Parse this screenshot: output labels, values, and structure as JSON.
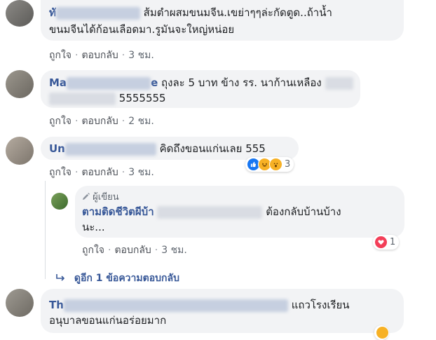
{
  "comments": [
    {
      "name_visible": "ทั",
      "text": "ส้มตำผสมขนมจีน.เขย่าๆๆล่ะกัดตูด..ถ้าน้ำ",
      "text2": "ขนมจีนได้ก้อนเลือดมา.รูมันจะใหญ่หน่อย",
      "like": "ถูกใจ",
      "reply": "ตอบกลับ",
      "time": "3 ชม."
    },
    {
      "name_visible": "Ma",
      "name_suffix": "e",
      "text": "ถุงละ 5 บาท ข้าง รร. นาก้านเหลือง",
      "text2": "5555555",
      "like": "ถูกใจ",
      "reply": "ตอบกลับ",
      "time": "2 ชม."
    },
    {
      "name_visible": "Un",
      "text": "คิดถึงขอนแก่นเลย 555",
      "like": "ถูกใจ",
      "reply": "ตอบกลับ",
      "time": "3 ชม.",
      "reaction_count": "3"
    },
    {
      "author_badge": "ผู้เขียน",
      "name": "ตามติดชีวิตผีบ้า",
      "text": "ต้องกลับบ้านบ้าง",
      "text2": "นะ...",
      "like": "ถูกใจ",
      "reply": "ตอบกลับ",
      "time": "3 ชม.",
      "reaction_count": "1"
    },
    {
      "name_visible": "Th",
      "text": "แถวโรงเรียน",
      "text2": "อนุบาลขอนแก่นอร่อยมาก"
    }
  ],
  "more_replies": "ดูอีก 1 ข้อความตอบกลับ",
  "separator": "·",
  "icons": {
    "like": "thumbs-up-icon",
    "haha": "haha-icon",
    "wow": "wow-icon",
    "love": "heart-icon",
    "pencil": "pencil-icon",
    "reply_arrow": "reply-arrow-icon"
  },
  "colors": {
    "name": "#385898",
    "bubble": "#f2f3f5",
    "meta": "#606770",
    "like_blue": "#1877f2",
    "love_red": "#f33e58",
    "haha_yellow": "#f7b125"
  }
}
